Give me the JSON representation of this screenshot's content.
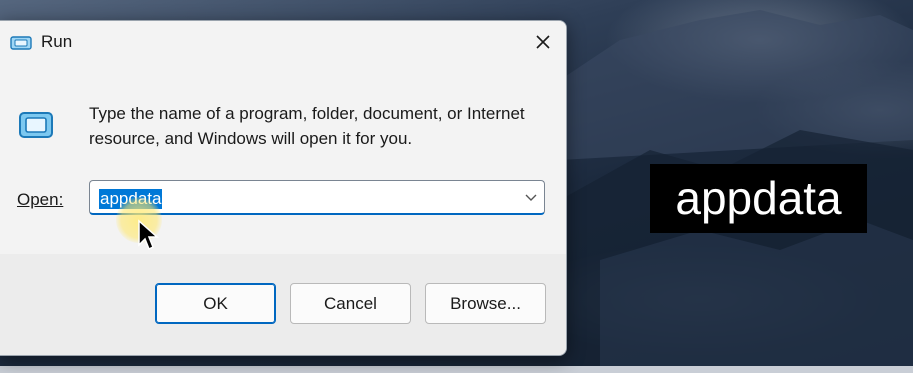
{
  "dialog": {
    "title": "Run",
    "description": "Type the name of a program, folder, document, or Internet resource, and Windows will open it for you.",
    "open_label": "Open:",
    "open_value": "appdata",
    "buttons": {
      "ok": "OK",
      "cancel": "Cancel",
      "browse": "Browse..."
    }
  },
  "overlay": {
    "text": "appdata"
  },
  "colors": {
    "accent": "#0067c0",
    "selection": "#0078d7"
  }
}
